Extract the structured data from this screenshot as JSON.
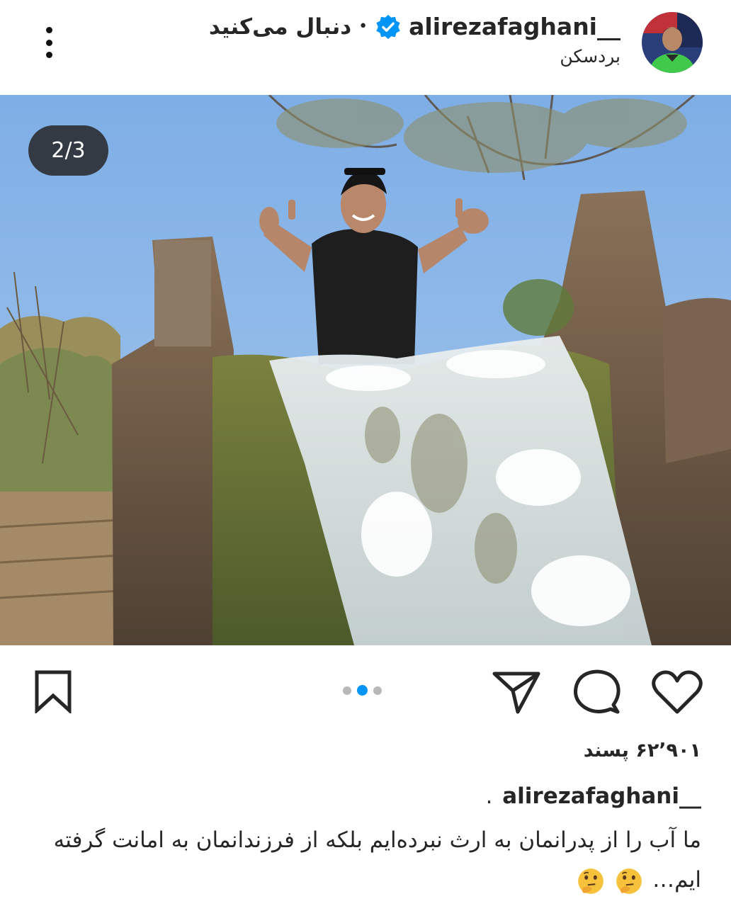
{
  "header": {
    "username": "alirezafaghani__",
    "follow_status": "دنبال می‌کنید",
    "separator": "•",
    "location": "بردسکن",
    "more_icon": "more-vertical-icon",
    "verified_icon": "verified-badge-icon"
  },
  "photo": {
    "counter": "2/3",
    "sky_color": "#8db6e6"
  },
  "actions": {
    "like_icon": "heart-icon",
    "comment_icon": "comment-icon",
    "share_icon": "send-icon",
    "save_icon": "bookmark-icon",
    "carousel_pages": 3,
    "carousel_active_index": 1,
    "accent_color": "#0095f6"
  },
  "post": {
    "likes_text": "۶۲٬۹۰۱ پسند",
    "caption_username": "alirezafaghani__",
    "caption_dot": ".",
    "caption_text": "ما  آب را از پدرانمان به ارث نبرده‌ایم بلکه از فرزندانمان به امانت گرفته ایم…",
    "caption_emojis": [
      "thinking-face",
      "thinking-face"
    ]
  }
}
